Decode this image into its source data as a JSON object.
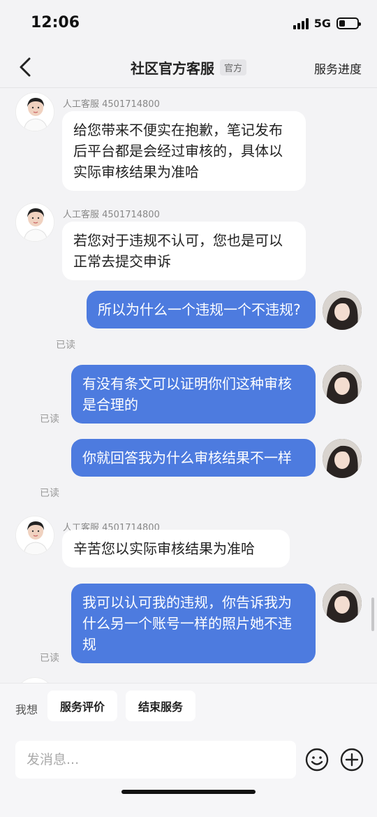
{
  "status_bar": {
    "time": "12:06",
    "network": "5G",
    "battery_level": 0.35
  },
  "nav": {
    "title": "社区官方客服",
    "badge": "官方",
    "right_action": "服务进度",
    "back_icon": "chevron-left-icon"
  },
  "messages": [
    {
      "sender": "agent",
      "sender_label": "人工客服 4501714800",
      "text": "给您带来不便实在抱歉，笔记发布后平台都是会经过审核的，具体以实际审核结果为准哈"
    },
    {
      "sender": "agent",
      "sender_label": "人工客服 4501714800",
      "text": "若您对于违规不认可，您也是可以正常去提交申诉"
    },
    {
      "sender": "user",
      "status": "已读",
      "text": "所以为什么一个违规一个不违规?"
    },
    {
      "sender": "user",
      "status": "已读",
      "text": "有没有条文可以证明你们这种审核是合理的"
    },
    {
      "sender": "user",
      "status": "已读",
      "text": "你就回答我为什么审核结果不一样"
    },
    {
      "sender": "agent",
      "sender_label": "人工客服 4501714800",
      "text": "辛苦您以实际审核结果为准哈"
    },
    {
      "sender": "user",
      "status": "已读",
      "text": "我可以认可我的违规，你告诉我为什么另一个账号一样的照片她不违规"
    }
  ],
  "quick_actions": {
    "label": "我想",
    "items": [
      "服务评价",
      "结束服务"
    ]
  },
  "composer": {
    "placeholder": "发消息...",
    "emoji_icon": "emoji-icon",
    "plus_icon": "plus-circle-icon"
  },
  "colors": {
    "user_bubble": "#4d7bdf",
    "agent_bubble": "#ffffff",
    "background": "#f3f3f5"
  }
}
